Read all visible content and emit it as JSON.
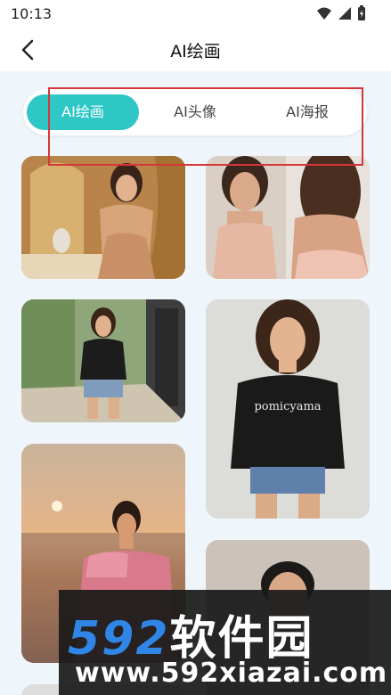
{
  "status": {
    "time": "10:13"
  },
  "header": {
    "title": "AI绘画"
  },
  "tabs": [
    {
      "label": "AI绘画",
      "active": true
    },
    {
      "label": "AI头像",
      "active": false
    },
    {
      "label": "AI海报",
      "active": false
    }
  ],
  "gallery": {
    "images": [
      "woman-beige-dress-gold-mirror",
      "woman-strapless-pink-gown-mirror",
      "woman-black-tshirt-street",
      "woman-black-tshirt-gray-backdrop",
      "woman-pink-dress-sunset-beach",
      "man-portrait-gray-backdrop"
    ],
    "tshirt_text": "pomicyama"
  },
  "watermark": {
    "brand_num": "592",
    "brand_cn": "软件园",
    "url": "www.592xiazai.com"
  },
  "colors": {
    "accent": "#2fc6c6",
    "highlight_box": "#d6363a",
    "watermark_blue": "#2f86e6"
  }
}
